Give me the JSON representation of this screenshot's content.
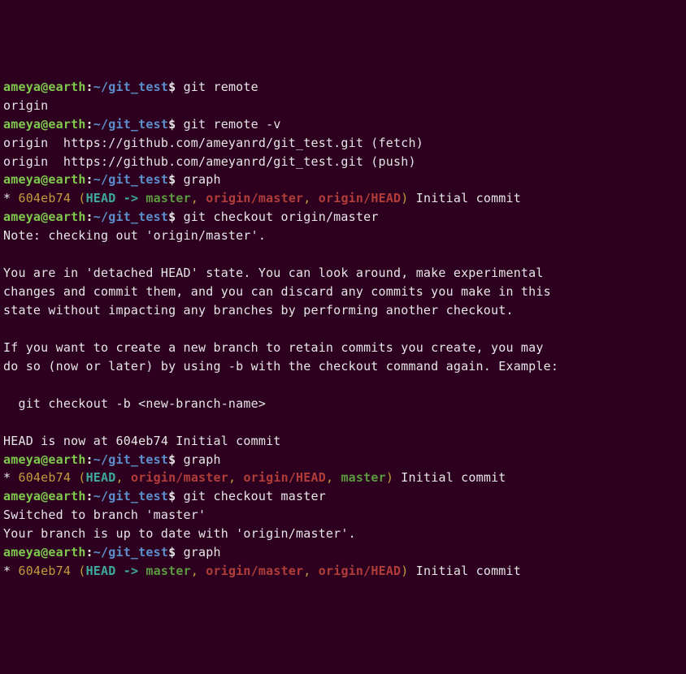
{
  "prompt": {
    "user": "ameya",
    "at": "@",
    "host": "earth",
    "colon": ":",
    "path": "~/git_test",
    "dollar": "$ "
  },
  "blocks": [
    {
      "type": "prompt",
      "cmd": "git remote"
    },
    {
      "type": "out",
      "text": "origin"
    },
    {
      "type": "prompt",
      "cmd": "git remote -v"
    },
    {
      "type": "out",
      "text": "origin  https://github.com/ameyanrd/git_test.git (fetch)"
    },
    {
      "type": "out",
      "text": "origin  https://github.com/ameyanrd/git_test.git (push)"
    },
    {
      "type": "prompt",
      "cmd": "graph"
    },
    {
      "type": "graph",
      "before": "* ",
      "hash": "604eb74",
      "open": " (",
      "head": "HEAD -> ",
      "branch": "master",
      "c1": ", ",
      "r1": "origin/master",
      "c2": ", ",
      "r2": "origin/HEAD",
      "close": ")",
      "msg": " Initial commit"
    },
    {
      "type": "prompt",
      "cmd": "git checkout origin/master"
    },
    {
      "type": "out",
      "text": "Note: checking out 'origin/master'."
    },
    {
      "type": "out",
      "text": ""
    },
    {
      "type": "out",
      "text": "You are in 'detached HEAD' state. You can look around, make experimental"
    },
    {
      "type": "out",
      "text": "changes and commit them, and you can discard any commits you make in this"
    },
    {
      "type": "out",
      "text": "state without impacting any branches by performing another checkout."
    },
    {
      "type": "out",
      "text": ""
    },
    {
      "type": "out",
      "text": "If you want to create a new branch to retain commits you create, you may"
    },
    {
      "type": "out",
      "text": "do so (now or later) by using -b with the checkout command again. Example:"
    },
    {
      "type": "out",
      "text": ""
    },
    {
      "type": "out",
      "text": "  git checkout -b <new-branch-name>"
    },
    {
      "type": "out",
      "text": ""
    },
    {
      "type": "out",
      "text": "HEAD is now at 604eb74 Initial commit"
    },
    {
      "type": "prompt",
      "cmd": "graph"
    },
    {
      "type": "graph2",
      "before": "* ",
      "hash": "604eb74",
      "open": " (",
      "head": "HEAD",
      "c0": ", ",
      "r1": "origin/master",
      "c1": ", ",
      "r2": "origin/HEAD",
      "c2": ", ",
      "branch": "master",
      "close": ")",
      "msg": " Initial commit"
    },
    {
      "type": "prompt",
      "cmd": "git checkout master"
    },
    {
      "type": "out",
      "text": "Switched to branch 'master'"
    },
    {
      "type": "out",
      "text": "Your branch is up to date with 'origin/master'."
    },
    {
      "type": "prompt",
      "cmd": "graph"
    },
    {
      "type": "graph",
      "before": "* ",
      "hash": "604eb74",
      "open": " (",
      "head": "HEAD -> ",
      "branch": "master",
      "c1": ", ",
      "r1": "origin/master",
      "c2": ", ",
      "r2": "origin/HEAD",
      "close": ")",
      "msg": " Initial commit"
    }
  ]
}
